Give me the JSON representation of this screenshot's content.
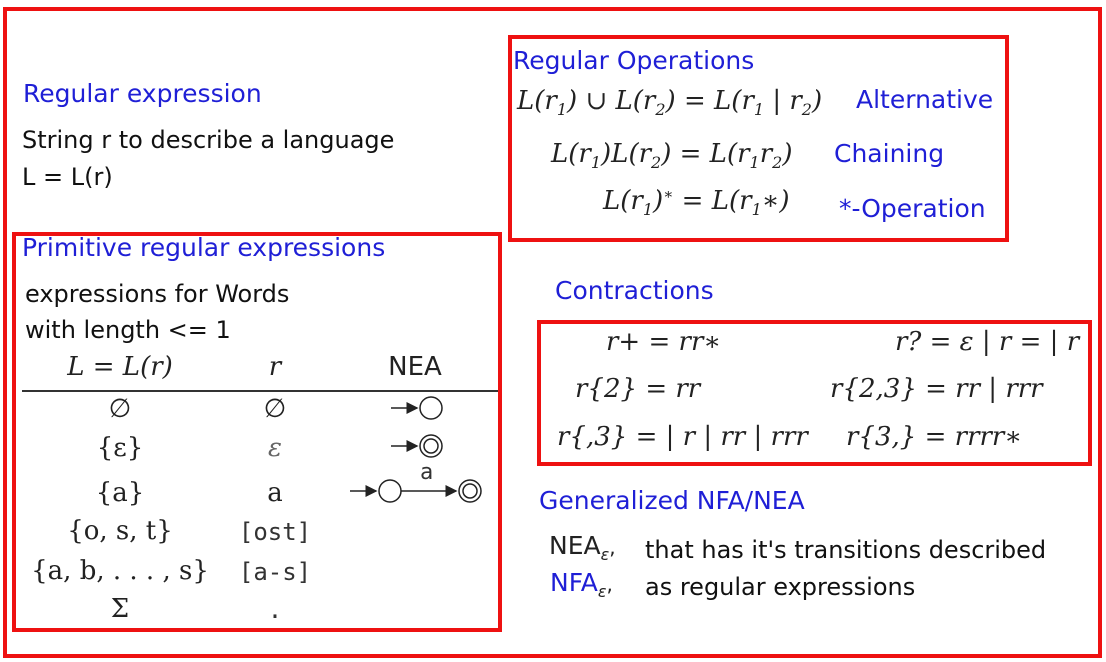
{
  "title": "Regular expression",
  "intro": {
    "line1": "String r to describe a language",
    "line2": "L = L(r)"
  },
  "primitive": {
    "heading": "Primitive regular expressions",
    "desc1": "expressions for Words",
    "desc2": "with length <= 1",
    "headers": {
      "lang": "L = L(r)",
      "r": "r",
      "nea": "NEA"
    },
    "rows": [
      {
        "lang": "∅",
        "r": "∅",
        "nea": "start-state"
      },
      {
        "lang": "{ε}",
        "r": "ε",
        "nea": "start-accept-state"
      },
      {
        "lang": "{a}",
        "r": "a",
        "nea": "a"
      },
      {
        "lang": "{o, s, t}",
        "r": "[ost]"
      },
      {
        "lang": "{a, b, . . . , s}",
        "r": "[a-s]"
      },
      {
        "lang": "Σ",
        "r": "."
      }
    ]
  },
  "regular_operations": {
    "heading": "Regular Operations",
    "ops": [
      {
        "label": "Alternative"
      },
      {
        "label": "Chaining"
      },
      {
        "label": "*-Operation"
      }
    ]
  },
  "contractions": {
    "heading": "Contractions",
    "items": [
      "r+ = rr∗",
      "r? = ε | r = | r",
      "r{2} = rr",
      "r{2,3} = rr | rrr",
      "r{,3} = | r | rr | rrr",
      "r{3,} = rrrr∗"
    ]
  },
  "generalized": {
    "heading": "Generalized NFA/NEA",
    "nea_label": "NEA",
    "nfa_label": "NFA",
    "eps": "ε",
    "comma": ",",
    "desc1": "that has it's transitions described",
    "desc2": "as regular expressions"
  },
  "colors": {
    "frame": "#ee1111",
    "heading_blue": "#1f1fd6"
  }
}
